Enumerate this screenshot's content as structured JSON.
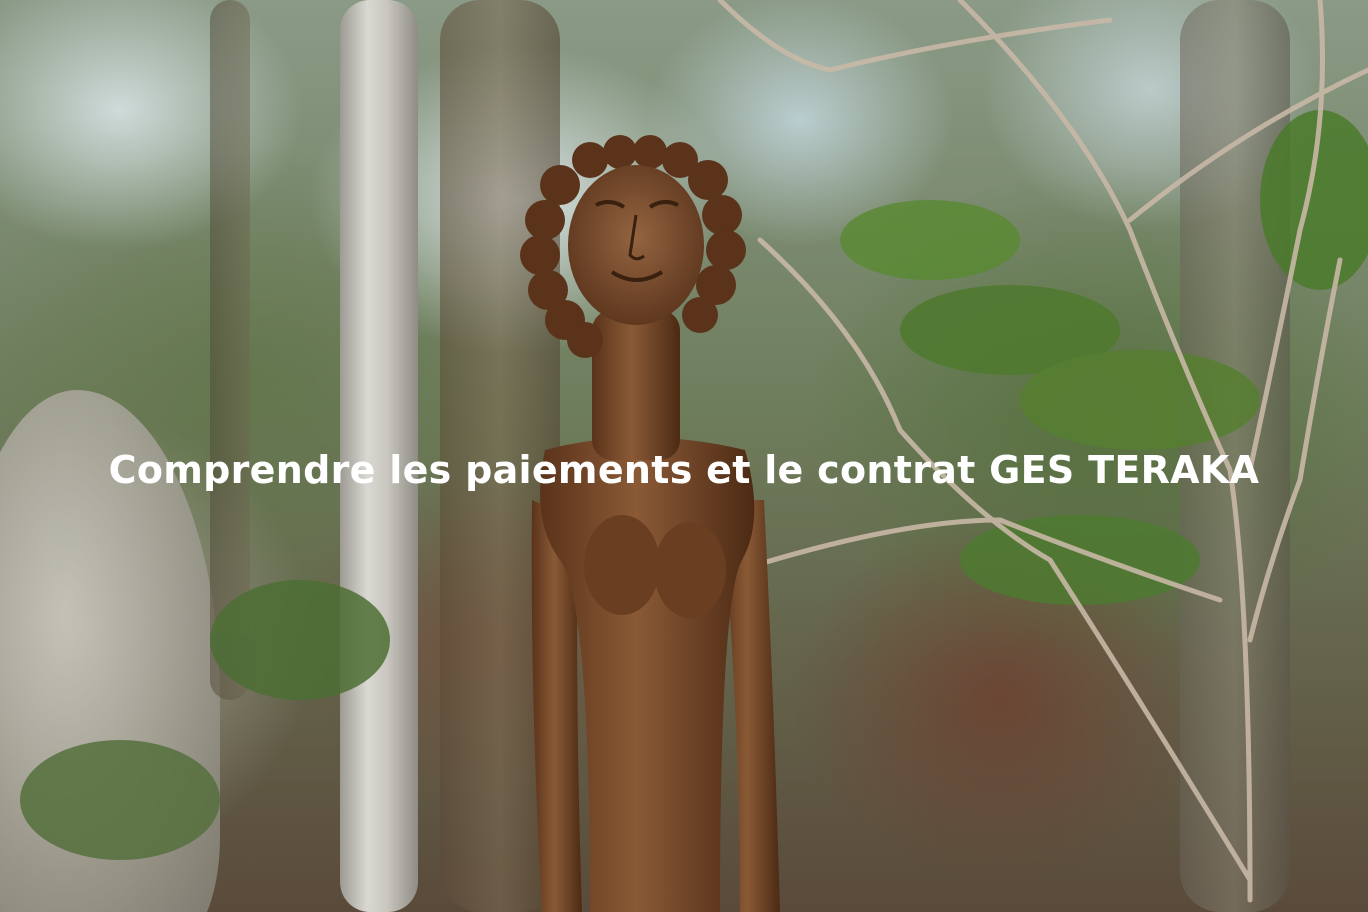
{
  "photo": {
    "subject": "carved-wooden-figure",
    "colors": {
      "wood": "#7a4a2a",
      "wood_dark": "#4e2c16",
      "foliage": "#4f7a2e",
      "sky": "#dfe8ea",
      "overlay_text": "#ffffff"
    }
  },
  "overlay": {
    "caption": "Comprendre les paiements et le contrat GES TERAKA"
  }
}
